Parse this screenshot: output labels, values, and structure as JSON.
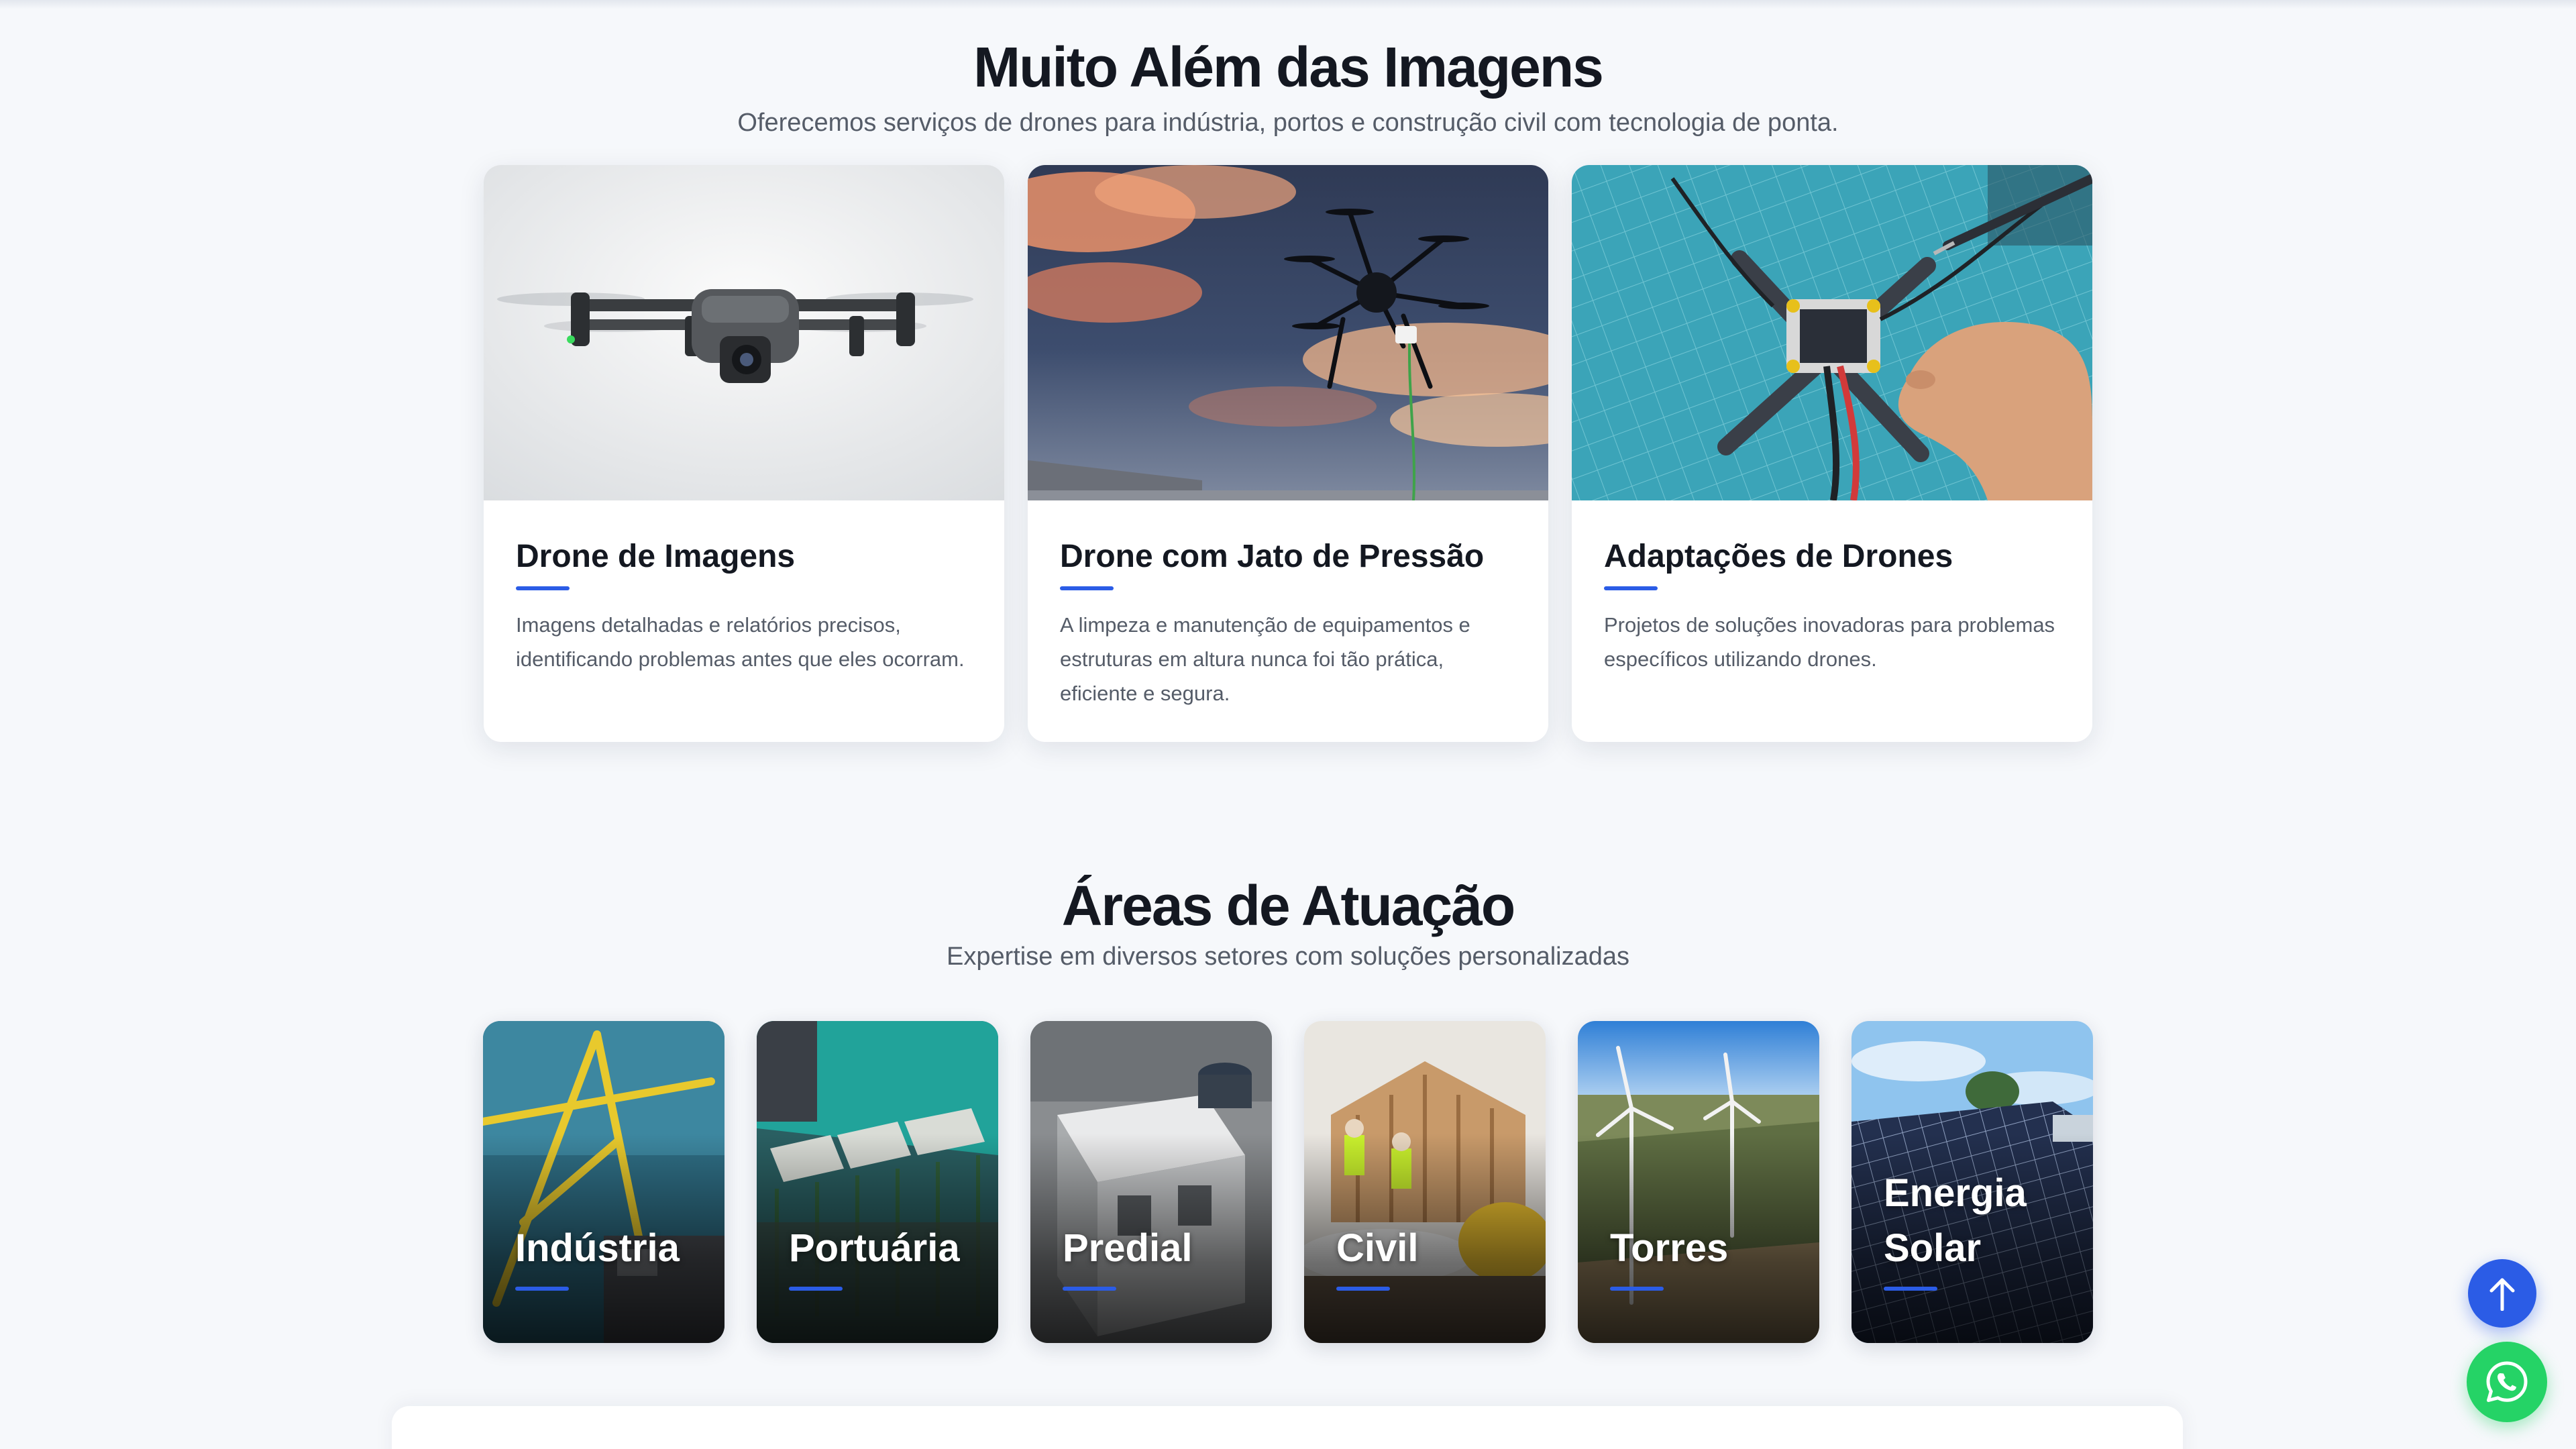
{
  "services": {
    "title": "Muito Além das Imagens",
    "subtitle": "Oferecemos serviços de drones para indústria, portos e construção civil com tecnologia de ponta.",
    "cards": [
      {
        "title": "Drone de Imagens",
        "description": "Imagens detalhadas e relatórios precisos, identificando problemas antes que eles ocorram.",
        "image_icon": "quadcopter-photo"
      },
      {
        "title": "Drone com Jato de Pressão",
        "description": "A limpeza e manutenção de equipamentos e estruturas em altura nunca foi tão prática, eficiente e segura.",
        "image_icon": "hexacopter-sunset-photo"
      },
      {
        "title": "Adaptações de Drones",
        "description": "Projetos de soluções inovadoras para problemas específicos utilizando drones.",
        "image_icon": "drone-assembly-photo"
      }
    ]
  },
  "areas": {
    "title": "Áreas de Atuação",
    "subtitle": "Expertise em diversos setores com soluções personalizadas",
    "items": [
      {
        "label": "Indústria"
      },
      {
        "label": "Portuária"
      },
      {
        "label": "Predial"
      },
      {
        "label": "Civil"
      },
      {
        "label": "Torres"
      },
      {
        "label": "Energia Solar"
      }
    ]
  },
  "floating": {
    "scroll_top_icon": "arrow-up-icon",
    "whatsapp_icon": "whatsapp-icon"
  },
  "colors": {
    "accent": "#2b5ce6",
    "whatsapp": "#25d366",
    "background": "#f6f8fb"
  }
}
